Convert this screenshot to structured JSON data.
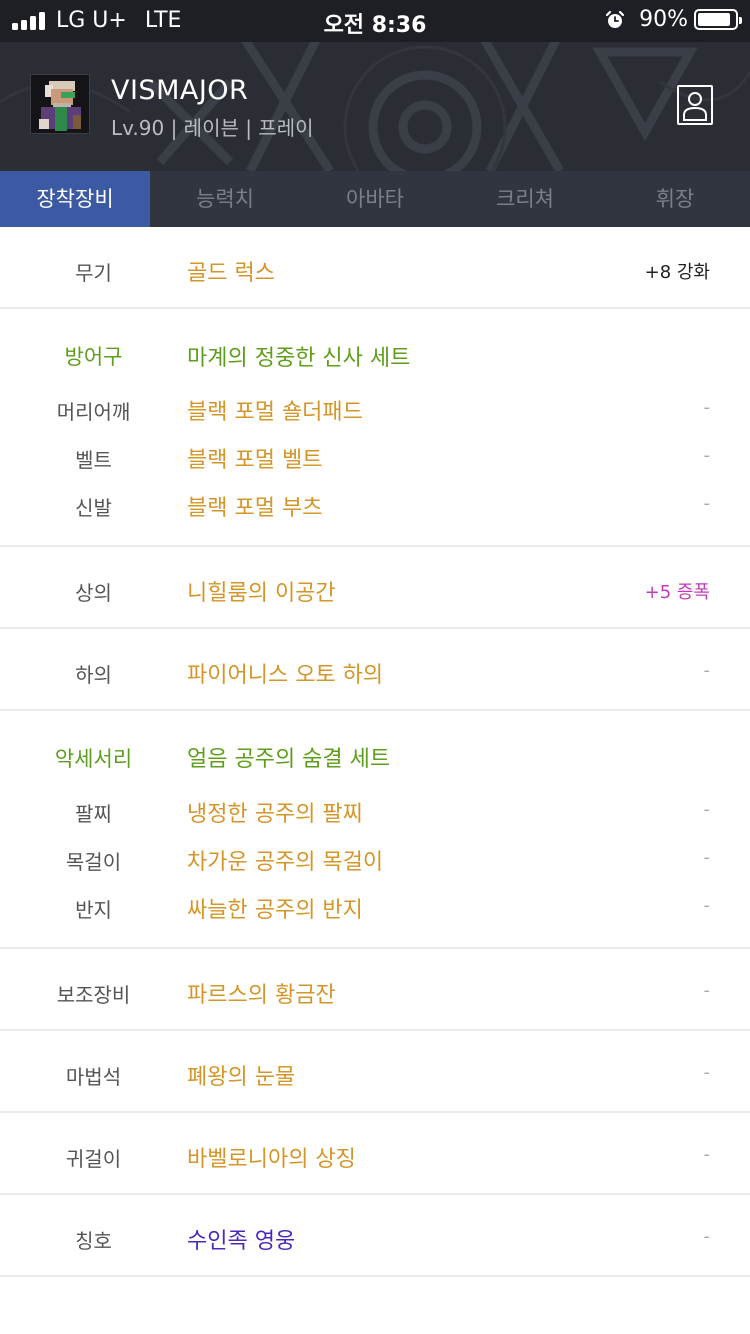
{
  "status": {
    "carrier": "LG U+",
    "network": "LTE",
    "time": "오전 8:36",
    "battery": "90%",
    "battery_level": 0.9
  },
  "profile": {
    "name": "VISMAJOR",
    "info": "Lv.90 | 레이븐 | 프레이"
  },
  "tabs": [
    {
      "label": "장착장비",
      "active": true
    },
    {
      "label": "능력치",
      "active": false
    },
    {
      "label": "아바타",
      "active": false
    },
    {
      "label": "크리쳐",
      "active": false
    },
    {
      "label": "휘장",
      "active": false
    }
  ],
  "equipment": {
    "weapon": {
      "slot": "무기",
      "item": "골드 럭스",
      "extra": "+8 강화"
    },
    "armor": {
      "set_label": "방어구",
      "set_name": "마계의 정중한 신사 세트",
      "items": [
        {
          "slot": "머리어깨",
          "item": "블랙 포멀 숄더패드",
          "extra": "-"
        },
        {
          "slot": "벨트",
          "item": "블랙 포멀 벨트",
          "extra": "-"
        },
        {
          "slot": "신발",
          "item": "블랙 포멀 부츠",
          "extra": "-"
        }
      ]
    },
    "top": {
      "slot": "상의",
      "item": "니힐룸의 이공간",
      "extra": "+5 증폭"
    },
    "bottom": {
      "slot": "하의",
      "item": "파이어니스 오토 하의",
      "extra": "-"
    },
    "accessory": {
      "set_label": "악세서리",
      "set_name": "얼음 공주의 숨결 세트",
      "items": [
        {
          "slot": "팔찌",
          "item": "냉정한 공주의 팔찌",
          "extra": "-"
        },
        {
          "slot": "목걸이",
          "item": "차가운 공주의 목걸이",
          "extra": "-"
        },
        {
          "slot": "반지",
          "item": "싸늘한 공주의 반지",
          "extra": "-"
        }
      ]
    },
    "sub": {
      "slot": "보조장비",
      "item": "파르스의 황금잔",
      "extra": "-"
    },
    "magic": {
      "slot": "마법석",
      "item": "폐왕의 눈물",
      "extra": "-"
    },
    "earring": {
      "slot": "귀걸이",
      "item": "바벨로니아의 상징",
      "extra": "-"
    },
    "title": {
      "slot": "칭호",
      "item": "수인족 영웅",
      "extra": "-"
    }
  },
  "colors": {
    "item_gold": "#d49628",
    "set_green": "#5f9e1c",
    "title_purple": "#4b29b8",
    "amplify_magenta": "#c43ab8",
    "tab_active": "#3c5aa4"
  }
}
